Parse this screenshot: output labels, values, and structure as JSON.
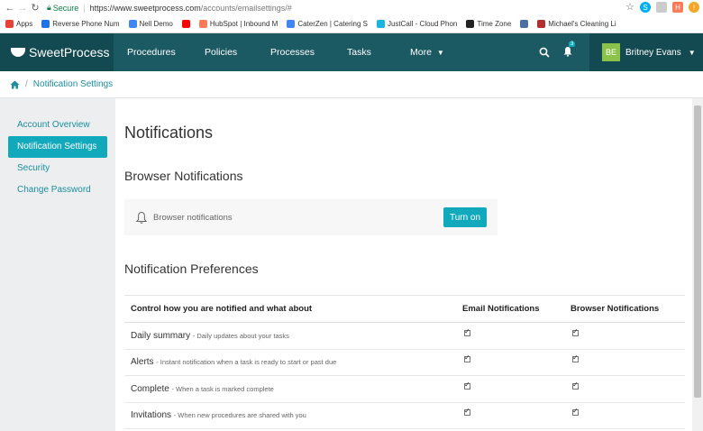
{
  "browser": {
    "secure_label": "Secure",
    "url_host": "https://www.sweetprocess.com",
    "url_path": "/accounts/emailsettings/#",
    "bookmarks": [
      {
        "label": "Apps",
        "color": "#e94235"
      },
      {
        "label": "Reverse Phone Num",
        "color": "#1a73e8"
      },
      {
        "label": "Nell Demo",
        "color": "#4285f4"
      },
      {
        "label": "",
        "color": "#ff0000"
      },
      {
        "label": "HubSpot | Inbound M",
        "color": "#ff7a59"
      },
      {
        "label": "CaterZen | Catering S",
        "color": "#4285f4"
      },
      {
        "label": "JustCall - Cloud Phon",
        "color": "#19b4e2"
      },
      {
        "label": "Time Zone",
        "color": "#222222"
      },
      {
        "label": "",
        "color": "#4a6fa5"
      },
      {
        "label": "Michael's Cleaning Li",
        "color": "#b03030"
      }
    ]
  },
  "header": {
    "logo": "SweetProcess",
    "nav": [
      "Procedures",
      "Policies",
      "Processes",
      "Tasks",
      "More"
    ],
    "notification_count": "3",
    "user_initials": "BE",
    "user_name": "Britney Evans"
  },
  "breadcrumb": {
    "current": "Notification Settings"
  },
  "sidebar": {
    "items": [
      "Account Overview",
      "Notification Settings",
      "Security",
      "Change Password"
    ]
  },
  "main": {
    "title": "Notifications",
    "browser_section_title": "Browser Notifications",
    "browser_label": "Browser notifications",
    "turn_on_label": "Turn on",
    "prefs_title": "Notification Preferences",
    "columns": [
      "Control how you are notified and what about",
      "Email Notifications",
      "Browser Notifications"
    ],
    "rows": [
      {
        "name": "Daily summary",
        "desc": "- Daily updates about your tasks",
        "email": true,
        "browser": true
      },
      {
        "name": "Alerts",
        "desc": "- Instant notification when a task is ready to start or past due",
        "email": true,
        "browser": true
      },
      {
        "name": "Complete",
        "desc": "- When a task is marked complete",
        "email": true,
        "browser": true
      },
      {
        "name": "Invitations",
        "desc": "- When new procedures are shared with you",
        "email": true,
        "browser": true
      }
    ]
  },
  "colors": {
    "header_bg": "#1b5963",
    "accent": "#13a9bd",
    "link": "#1d8ea0"
  }
}
